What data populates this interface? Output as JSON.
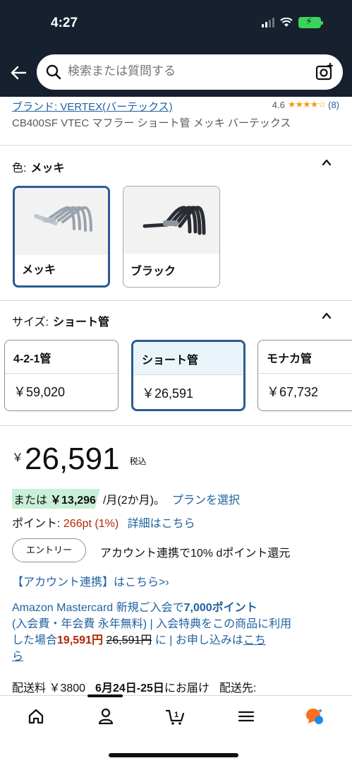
{
  "status_bar": {
    "time": "4:27"
  },
  "header": {
    "search_placeholder": "検索または質問する"
  },
  "product": {
    "brand_link": "ブランド: VERTEX(バーテックス)",
    "rating_value": "4.6",
    "rating_stars": "★★★★☆",
    "rating_count": "(8)",
    "title": "CB400SF VTEC マフラー ショート管 メッキ バーテックス"
  },
  "color_section": {
    "label": "色:",
    "selected": "メッキ",
    "options": [
      {
        "label": "メッキ",
        "selected": true
      },
      {
        "label": "ブラック",
        "selected": false
      }
    ]
  },
  "size_section": {
    "label": "サイズ:",
    "selected": "ショート管",
    "options": [
      {
        "name": "4-2-1管",
        "price": "￥59,020",
        "selected": false
      },
      {
        "name": "ショート管",
        "price": "￥26,591",
        "selected": true
      },
      {
        "name": "モナカ管",
        "price": "￥67,732",
        "selected": false
      }
    ]
  },
  "price": {
    "yen_symbol": "￥",
    "amount": "26,591",
    "tax_label": "税込"
  },
  "installment": {
    "prefix": "または",
    "amount": "￥13,296",
    "rest": "/月(2か月)。",
    "link": "プランを選択"
  },
  "points": {
    "label": "ポイント:",
    "value": "266pt",
    "percent": "(1%)",
    "link": "詳細はこちら"
  },
  "entry": {
    "button_label": "エントリー",
    "text": "アカウント連携で10% dポイント還元",
    "link": "【アカウント連携】はこちら>›"
  },
  "card_offer": {
    "line1_a": "Amazon Mastercard 新規ご入会で",
    "line1_b": "7,000ポイント",
    "line2": "(入会費・年会費 永年無料) | 入会特典をこの商品に利用",
    "line3_a": "した場合",
    "discount_price": "19,591円",
    "original_price": "26,591円",
    "line3_b": " に | お申し込みは",
    "line3_link": "こち",
    "line4": "ら"
  },
  "shipping": {
    "fee": "配送料 ￥3800",
    "dates": "6月24日-25日",
    "dates_suffix": "にお届け",
    "destination": "配送先:"
  },
  "tabbar": {
    "items": [
      "home",
      "account",
      "cart",
      "menu",
      "rufus"
    ],
    "cart_count": "1"
  }
}
